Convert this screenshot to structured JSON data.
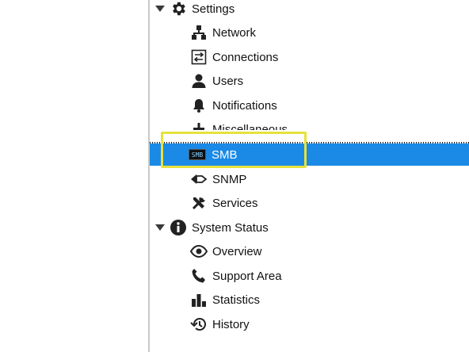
{
  "nav": {
    "settings": {
      "label": "Settings",
      "icon": "gear-icon",
      "items": [
        {
          "label": "Network",
          "icon": "network-icon"
        },
        {
          "label": "Connections",
          "icon": "connections-icon"
        },
        {
          "label": "Users",
          "icon": "user-icon"
        },
        {
          "label": "Notifications",
          "icon": "bell-icon"
        },
        {
          "label": "Miscellaneous",
          "icon": "misc-icon"
        },
        {
          "label": "SMB",
          "icon": "smb-icon",
          "badge": "SMB",
          "selected": true
        },
        {
          "label": "SNMP",
          "icon": "snmp-icon"
        },
        {
          "label": "Services",
          "icon": "tools-icon"
        }
      ]
    },
    "system_status": {
      "label": "System Status",
      "icon": "info-icon",
      "items": [
        {
          "label": "Overview",
          "icon": "eye-icon"
        },
        {
          "label": "Support Area",
          "icon": "phone-icon"
        },
        {
          "label": "Statistics",
          "icon": "bar-chart-icon"
        },
        {
          "label": "History",
          "icon": "history-icon"
        }
      ]
    }
  },
  "colors": {
    "selection": "#1a8ae6",
    "highlight_box": "#e6e23c"
  }
}
